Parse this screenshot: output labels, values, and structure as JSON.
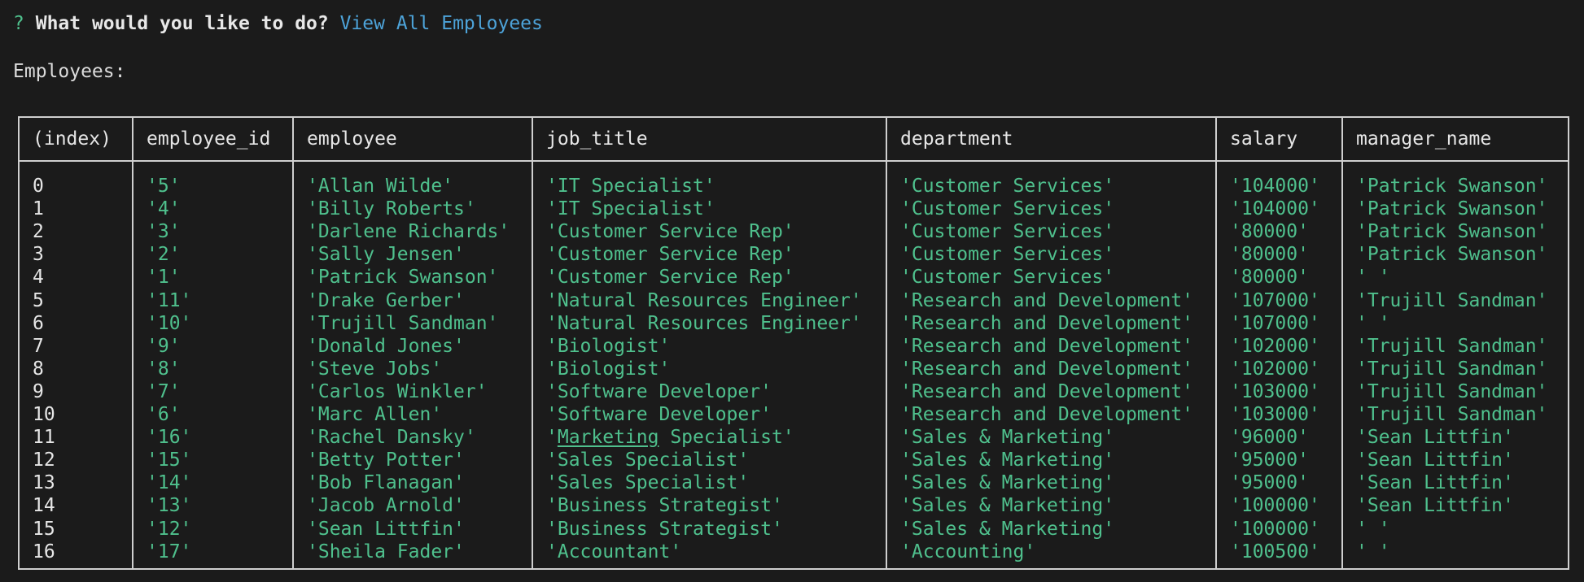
{
  "prompt": {
    "mark": "?",
    "question": "What would you like to do?",
    "answer": "View All Employees"
  },
  "heading": "Employees:",
  "table": {
    "columns": [
      "(index)",
      "employee_id",
      "employee",
      "job_title",
      "department",
      "salary",
      "manager_name"
    ],
    "rows": [
      [
        "0",
        "'5'",
        "'Allan Wilde'",
        "'IT Specialist'",
        "'Customer Services'",
        "'104000'",
        "'Patrick Swanson'"
      ],
      [
        "1",
        "'4'",
        "'Billy Roberts'",
        "'IT Specialist'",
        "'Customer Services'",
        "'104000'",
        "'Patrick Swanson'"
      ],
      [
        "2",
        "'3'",
        "'Darlene Richards'",
        "'Customer Service Rep'",
        "'Customer Services'",
        "'80000'",
        "'Patrick Swanson'"
      ],
      [
        "3",
        "'2'",
        "'Sally Jensen'",
        "'Customer Service Rep'",
        "'Customer Services'",
        "'80000'",
        "'Patrick Swanson'"
      ],
      [
        "4",
        "'1'",
        "'Patrick Swanson'",
        "'Customer Service Rep'",
        "'Customer Services'",
        "'80000'",
        "' '"
      ],
      [
        "5",
        "'11'",
        "'Drake Gerber'",
        "'Natural Resources Engineer'",
        "'Research and Development'",
        "'107000'",
        "'Trujill Sandman'"
      ],
      [
        "6",
        "'10'",
        "'Trujill Sandman'",
        "'Natural Resources Engineer'",
        "'Research and Development'",
        "'107000'",
        "' '"
      ],
      [
        "7",
        "'9'",
        "'Donald Jones'",
        "'Biologist'",
        "'Research and Development'",
        "'102000'",
        "'Trujill Sandman'"
      ],
      [
        "8",
        "'8'",
        "'Steve Jobs'",
        "'Biologist'",
        "'Research and Development'",
        "'102000'",
        "'Trujill Sandman'"
      ],
      [
        "9",
        "'7'",
        "'Carlos Winkler'",
        "'Software Developer'",
        "'Research and Development'",
        "'103000'",
        "'Trujill Sandman'"
      ],
      [
        "10",
        "'6'",
        "'Marc Allen'",
        "'Software Developer'",
        "'Research and Development'",
        "'103000'",
        "'Trujill Sandman'"
      ],
      [
        "11",
        "'16'",
        "'Rachel Dansky'",
        "'Marketing Specialist'",
        "'Sales & Marketing'",
        "'96000'",
        "'Sean Littfin'"
      ],
      [
        "12",
        "'15'",
        "'Betty Potter'",
        "'Sales Specialist'",
        "'Sales & Marketing'",
        "'95000'",
        "'Sean Littfin'"
      ],
      [
        "13",
        "'14'",
        "'Bob Flanagan'",
        "'Sales Specialist'",
        "'Sales & Marketing'",
        "'95000'",
        "'Sean Littfin'"
      ],
      [
        "14",
        "'13'",
        "'Jacob Arnold'",
        "'Business Strategist'",
        "'Sales & Marketing'",
        "'100000'",
        "'Sean Littfin'"
      ],
      [
        "15",
        "'12'",
        "'Sean Littfin'",
        "'Business Strategist'",
        "'Sales & Marketing'",
        "'100000'",
        "' '"
      ],
      [
        "16",
        "'17'",
        "'Sheila Fader'",
        "'Accountant'",
        "'Accounting'",
        "'100500'",
        "' '"
      ]
    ]
  },
  "colors": {
    "background": "#1b1b1b",
    "prompt_mark": "#4fc08d",
    "answer": "#4da3d9",
    "value_text": "#4fc08d",
    "border": "#cfcfcf"
  }
}
